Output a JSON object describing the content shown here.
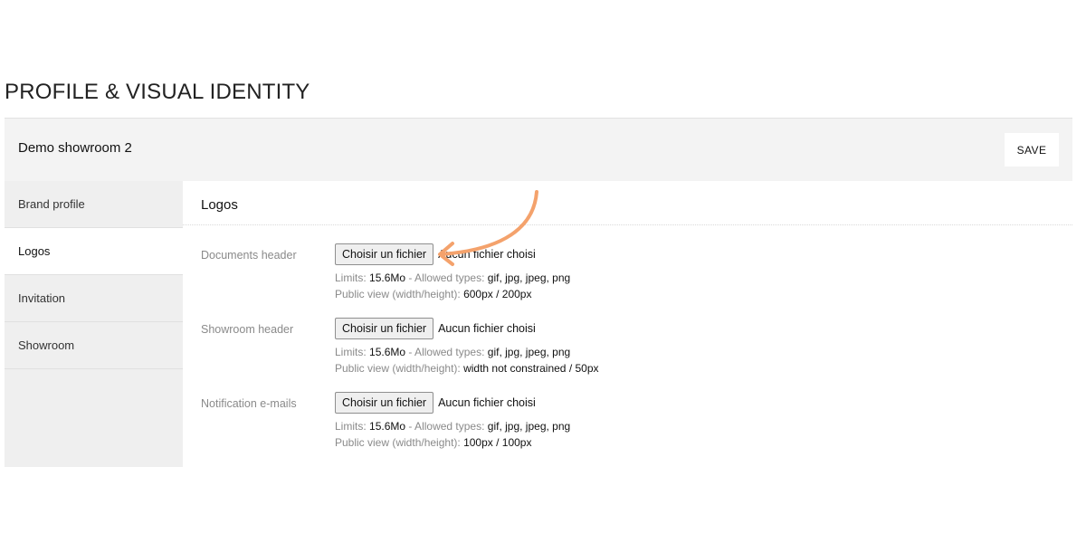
{
  "page_title": "PROFILE & VISUAL IDENTITY",
  "header": {
    "showroom_name": "Demo showroom 2",
    "save_label": "SAVE"
  },
  "sidebar": {
    "items": [
      {
        "label": "Brand profile",
        "active": false
      },
      {
        "label": "Logos",
        "active": true
      },
      {
        "label": "Invitation",
        "active": false
      },
      {
        "label": "Showroom",
        "active": false
      }
    ]
  },
  "section": {
    "title": "Logos",
    "fields": [
      {
        "label": "Documents header",
        "button_label": "Choisir un fichier",
        "status": "Aucun fichier choisi",
        "limits_label": "Limits:",
        "limits_value": "15.6Mo",
        "types_label": "- Allowed types:",
        "types_value": "gif, jpg, jpeg, png",
        "view_label": "Public view (width/height):",
        "view_value": "600px / 200px"
      },
      {
        "label": "Showroom header",
        "button_label": "Choisir un fichier",
        "status": "Aucun fichier choisi",
        "limits_label": "Limits:",
        "limits_value": "15.6Mo",
        "types_label": "- Allowed types:",
        "types_value": "gif, jpg, jpeg, png",
        "view_label": "Public view (width/height):",
        "view_value": "width not constrained / 50px"
      },
      {
        "label": "Notification e-mails",
        "button_label": "Choisir un fichier",
        "status": "Aucun fichier choisi",
        "limits_label": "Limits:",
        "limits_value": "15.6Mo",
        "types_label": "- Allowed types:",
        "types_value": "gif, jpg, jpeg, png",
        "view_label": "Public view (width/height):",
        "view_value": "100px / 100px"
      }
    ]
  },
  "colors": {
    "annotation_arrow": "#f4a26c",
    "header_background": "#f3f3f3",
    "sidebar_background": "#efefef"
  },
  "annotation": {
    "icon": "curved-arrow-icon"
  }
}
